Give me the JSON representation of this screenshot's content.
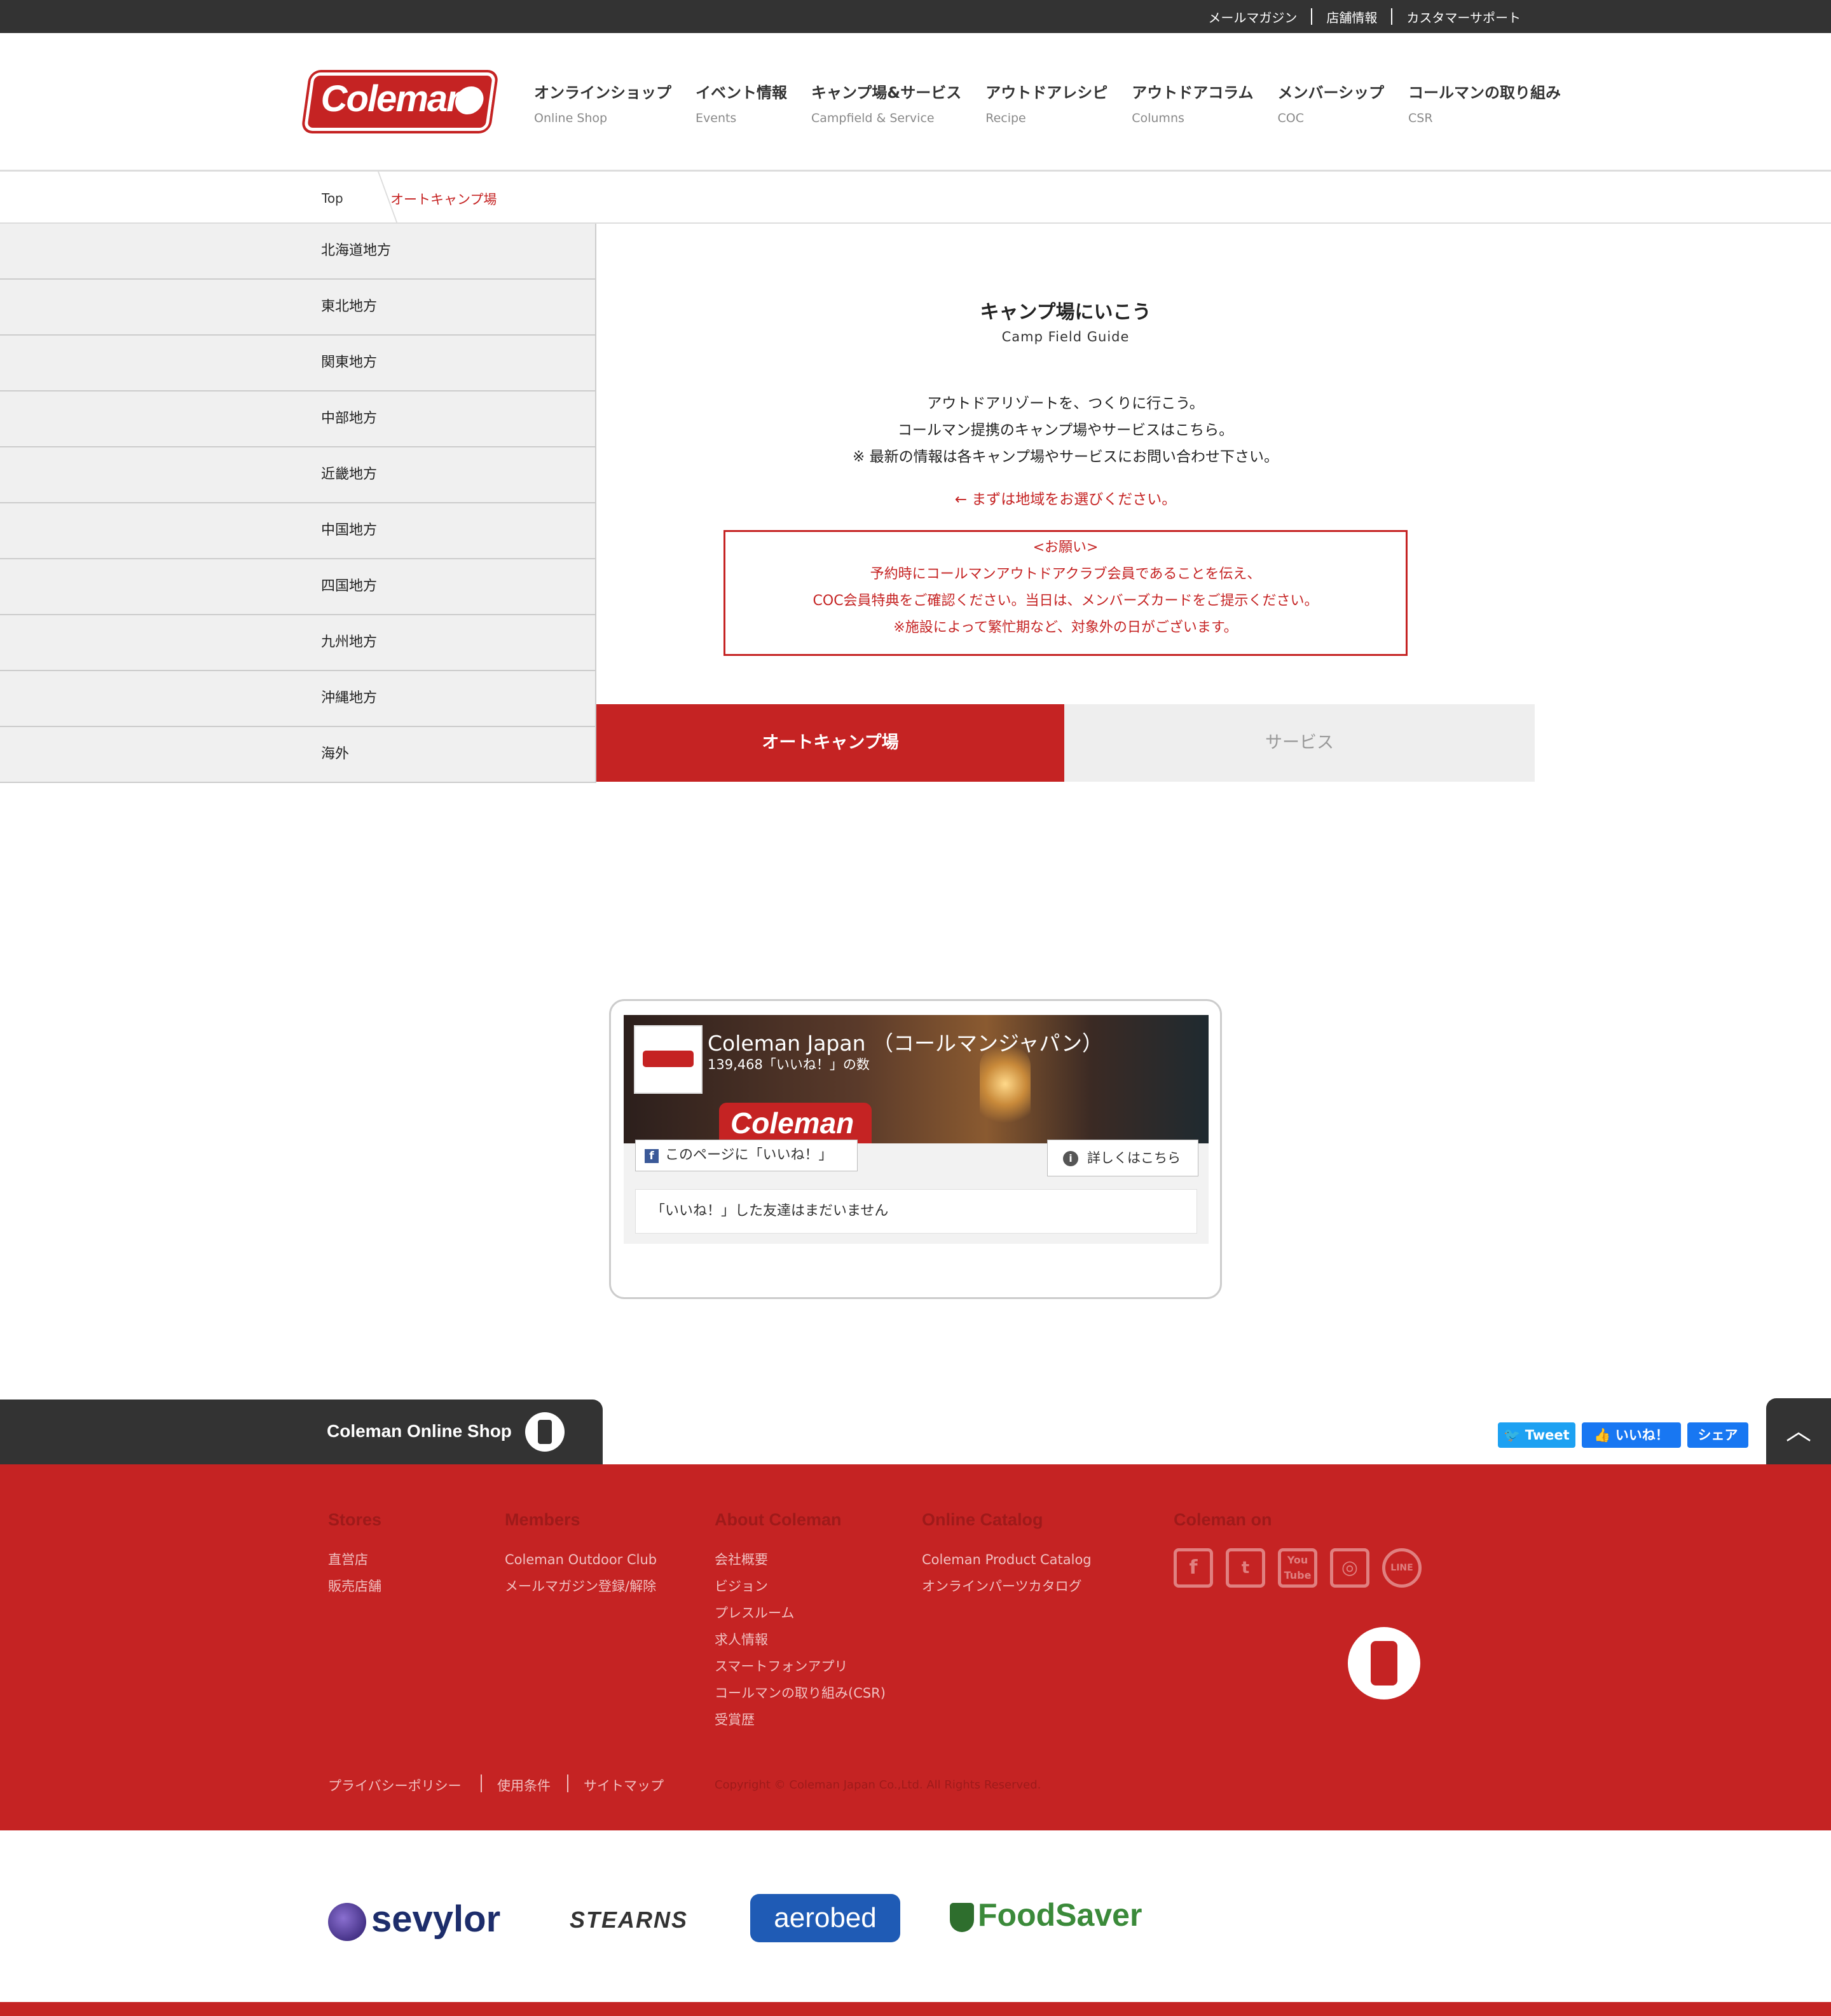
{
  "topbar": {
    "links": [
      "メールマガジン",
      "店舗情報",
      "カスタマーサポート"
    ]
  },
  "logo": {
    "text": "Coleman"
  },
  "nav": [
    {
      "jp": "オンラインショップ",
      "en": "Online Shop"
    },
    {
      "jp": "イベント情報",
      "en": "Events"
    },
    {
      "jp": "キャンプ場&サービス",
      "en": "Campfield & Service"
    },
    {
      "jp": "アウトドアレシピ",
      "en": "Recipe"
    },
    {
      "jp": "アウトドアコラム",
      "en": "Columns"
    },
    {
      "jp": "メンバーシップ",
      "en": "COC"
    },
    {
      "jp": "コールマンの取り組み",
      "en": "CSR"
    }
  ],
  "breadcrumb": {
    "top": "Top",
    "current": "オートキャンプ場"
  },
  "regions": [
    "北海道地方",
    "東北地方",
    "関東地方",
    "中部地方",
    "近畿地方",
    "中国地方",
    "四国地方",
    "九州地方",
    "沖縄地方",
    "海外"
  ],
  "main": {
    "title": "キャンプ場にいこう",
    "subtitle": "Camp Field Guide",
    "desc1": "アウトドアリゾートを、つくりに行こう。",
    "desc2": "コールマン提携のキャンプ場やサービスはこちら。",
    "desc3": "※ 最新の情報は各キャンプ場やサービスにお問い合わせ下さい。",
    "pick": "← まずは地域をお選びください。",
    "notice": [
      "<お願い>",
      "予約時にコールマンアウトドアクラブ会員であることを伝え、",
      "COC会員特典をご確認ください。当日は、メンバーズカードをご提示ください。",
      "※施設によって繁忙期など、対象外の日がございます。"
    ],
    "tab_active": "オートキャンプ場",
    "tab_inactive": "サービス"
  },
  "facebook": {
    "name": "Coleman Japan （コールマンジャパン）",
    "likes": "139,468「いいね！」の数",
    "like_button": "このページに「いいね！」",
    "more_button": "詳しくはこちら",
    "friends": "「いいね！」した友達はまだいません"
  },
  "shoptab": {
    "label": "Coleman Online Shop"
  },
  "social_buttons": {
    "tweet": "Tweet",
    "like": "いいね！",
    "share": "シェア"
  },
  "footer": {
    "stores": {
      "heading": "Stores",
      "links": [
        "直営店",
        "販売店舗"
      ]
    },
    "members": {
      "heading": "Members",
      "links": [
        "Coleman Outdoor Club",
        "メールマガジン登録/解除"
      ]
    },
    "about": {
      "heading": "About Coleman",
      "links": [
        "会社概要",
        "ビジョン",
        "プレスルーム",
        "求人情報",
        "スマートフォンアプリ",
        "コールマンの取り組み(CSR)",
        "受賞歴"
      ]
    },
    "catalog": {
      "heading": "Online Catalog",
      "links": [
        "Coleman Product Catalog",
        "オンラインパーツカタログ"
      ]
    },
    "social": {
      "heading": "Coleman on",
      "icons": [
        "facebook-icon",
        "twitter-icon",
        "youtube-icon",
        "instagram-icon",
        "line-icon"
      ]
    },
    "bottom_links": [
      "プライバシーポリシー",
      "使用条件",
      "サイトマップ"
    ],
    "copyright": "Copyright © Coleman Japan Co.,Ltd. All Rights Reserved."
  },
  "brands": [
    "sevylor",
    "STEARNS",
    "aerobed",
    "FoodSaver"
  ],
  "colors": {
    "brand_red": "#c52323",
    "dark": "#333333",
    "inactive_tab": "#eeeeee"
  }
}
